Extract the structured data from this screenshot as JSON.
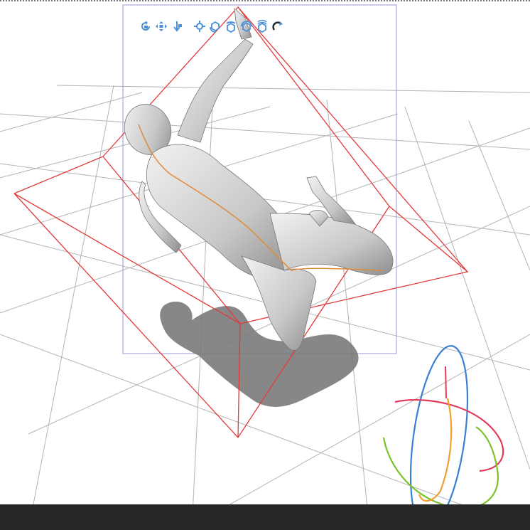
{
  "toolbar": {
    "tools": [
      {
        "icon": "rotate-camera-icon"
      },
      {
        "icon": "pan-camera-icon"
      },
      {
        "icon": "move-camera-icon"
      },
      {
        "icon": "move-object-icon"
      },
      {
        "icon": "rotate-object-icon"
      },
      {
        "icon": "rotate-object-y-icon"
      },
      {
        "icon": "rotate-object-z-icon"
      },
      {
        "icon": "reset-pose-icon"
      },
      {
        "icon": "snap-to-floor-icon"
      }
    ]
  },
  "colors": {
    "background": "#ffffff",
    "grid": "#b4b4b4",
    "bounding_box": "#e23a3a",
    "selection_frame": "#9a9ad6",
    "toolbar_icon": "#4a90d9",
    "bone_line": "#e08a3a",
    "gizmo_blue": "#3a7fd6",
    "gizmo_red": "#e23a5a",
    "gizmo_green": "#7cc22a",
    "gizmo_orange": "#f0a030",
    "bottom_bar": "#262626"
  }
}
